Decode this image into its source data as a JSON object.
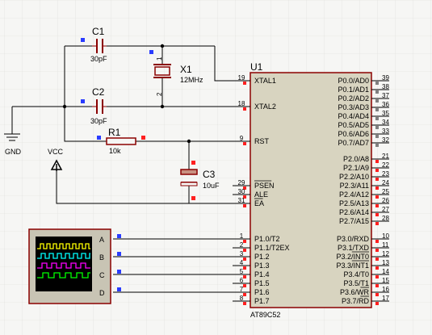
{
  "components": {
    "c1": {
      "ref": "C1",
      "value": "30pF"
    },
    "c2": {
      "ref": "C2",
      "value": "30pF"
    },
    "c3": {
      "ref": "C3",
      "value": "10uF"
    },
    "x1": {
      "ref": "X1",
      "value": "12MHz",
      "pin1": "1",
      "pin2": "2"
    },
    "r1": {
      "ref": "R1",
      "value": "10k"
    },
    "gnd": {
      "label": "GND"
    },
    "vcc": {
      "label": "VCC"
    },
    "oscilloscope": {
      "channels": [
        "A",
        "B",
        "C",
        "D"
      ],
      "trace_colors": [
        "#ffff00",
        "#00ffff",
        "#ff00ff",
        "#00ff00"
      ]
    }
  },
  "mcu": {
    "ref": "U1",
    "part": "AT89C52",
    "left_pins": [
      {
        "num": "19",
        "name": "XTAL1"
      },
      {
        "num": "18",
        "name": "XTAL2"
      },
      {
        "num": "9",
        "name": "RST"
      },
      {
        "num": "29",
        "name": "PSEN"
      },
      {
        "num": "30",
        "name": "ALE"
      },
      {
        "num": "31",
        "name": "EA"
      },
      {
        "num": "1",
        "name": "P1.0/T2"
      },
      {
        "num": "2",
        "name": "P1.1/T2EX"
      },
      {
        "num": "3",
        "name": "P1.2"
      },
      {
        "num": "4",
        "name": "P1.3"
      },
      {
        "num": "5",
        "name": "P1.4"
      },
      {
        "num": "6",
        "name": "P1.5"
      },
      {
        "num": "7",
        "name": "P1.6"
      },
      {
        "num": "8",
        "name": "P1.7"
      }
    ],
    "port0": [
      {
        "num": "39",
        "name": "P0.0/AD0"
      },
      {
        "num": "38",
        "name": "P0.1/AD1"
      },
      {
        "num": "37",
        "name": "P0.2/AD2"
      },
      {
        "num": "36",
        "name": "P0.3/AD3"
      },
      {
        "num": "35",
        "name": "P0.4/AD4"
      },
      {
        "num": "34",
        "name": "P0.5/AD5"
      },
      {
        "num": "33",
        "name": "P0.6/AD6"
      },
      {
        "num": "32",
        "name": "P0.7/AD7"
      }
    ],
    "port2": [
      {
        "num": "21",
        "name": "P2.0/A8"
      },
      {
        "num": "22",
        "name": "P2.1/A9"
      },
      {
        "num": "23",
        "name": "P2.2/A10"
      },
      {
        "num": "24",
        "name": "P2.3/A11"
      },
      {
        "num": "25",
        "name": "P2.4/A12"
      },
      {
        "num": "26",
        "name": "P2.5/A13"
      },
      {
        "num": "27",
        "name": "P2.6/A14"
      },
      {
        "num": "28",
        "name": "P2.7/A15"
      }
    ],
    "port3": [
      {
        "num": "10",
        "name": "P3.0/RXD"
      },
      {
        "num": "11",
        "name": "P3.1/TXD"
      },
      {
        "num": "12",
        "name": "P3.2/INT0"
      },
      {
        "num": "13",
        "name": "P3.3/INT1"
      },
      {
        "num": "14",
        "name": "P3.4/T0"
      },
      {
        "num": "15",
        "name": "P3.5/T1"
      },
      {
        "num": "16",
        "name": "P3.6/WR"
      },
      {
        "num": "17",
        "name": "P3.7/RD"
      }
    ]
  },
  "colors": {
    "wire": "#000000",
    "component_outline": "#8b0000",
    "chip_fill": "#d8d4c0",
    "scope_fill": "#c8c4b4",
    "marker_red": "#ff0000",
    "marker_blue": "#0000ff"
  }
}
